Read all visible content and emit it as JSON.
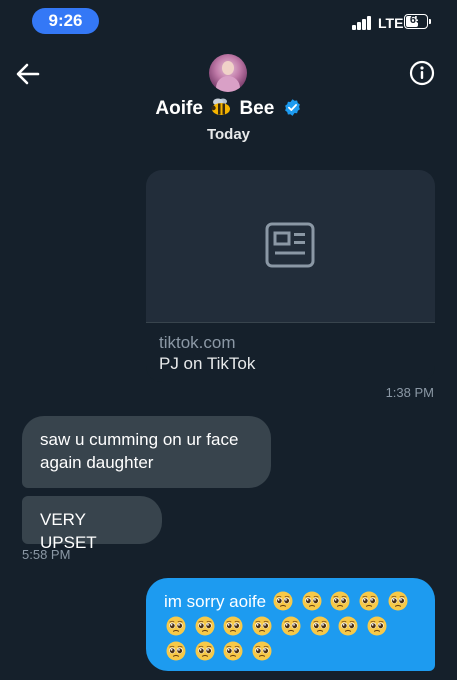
{
  "status_bar": {
    "time": "9:26",
    "network": "LTE",
    "battery_level": "65",
    "battery_fraction": 0.65
  },
  "header": {
    "contact_first_name": "Aoife",
    "contact_last_name": "Bee",
    "name_emoji": "bee-icon",
    "verified": true,
    "date_label": "Today"
  },
  "messages": {
    "link_card": {
      "domain": "tiktok.com",
      "title": "PJ on TikTok",
      "preview_icon": "news-article-icon",
      "timestamp": "1:38 PM"
    },
    "incoming": [
      {
        "text": "saw u cumming on ur face again daughter"
      },
      {
        "text": "VERY UPSET"
      }
    ],
    "incoming_timestamp": "5:58 PM",
    "outgoing": {
      "text": "im sorry aoife",
      "emoji": "pleading-face",
      "emoji_count": 17
    }
  },
  "colors": {
    "background": "#15202b",
    "incoming_bubble": "#38444d",
    "outgoing_bubble": "#1d9bf0",
    "verified_badge": "#1d9bf0",
    "time_pill": "#3478f6"
  }
}
